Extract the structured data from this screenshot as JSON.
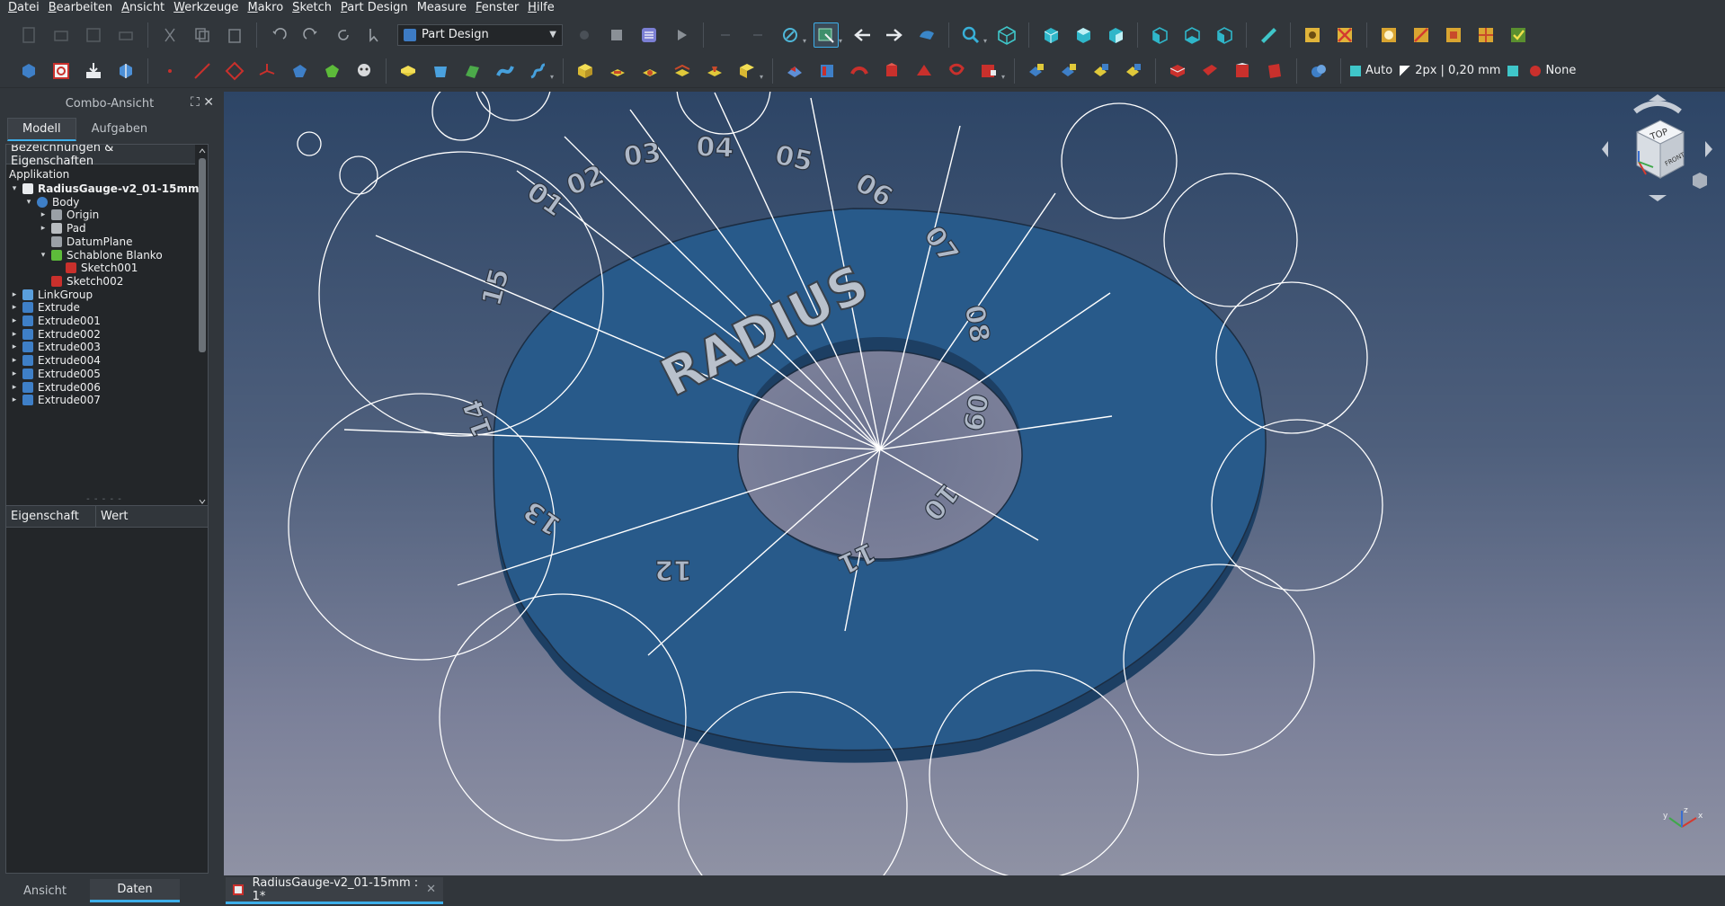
{
  "menu": [
    "Datei",
    "Bearbeiten",
    "Ansicht",
    "Werkzeuge",
    "Makro",
    "Sketch",
    "Part Design",
    "Measure",
    "Fenster",
    "Hilfe"
  ],
  "menu_mnemonics": [
    "D",
    "B",
    "A",
    "W",
    "M",
    "S",
    "P",
    "",
    "F",
    "H"
  ],
  "workbench": "Part Design",
  "toolbar2_draw": {
    "style": "Auto",
    "line": "2px | 0,20 mm",
    "fill": "None"
  },
  "combo": {
    "title": "Combo-Ansicht",
    "tabs": [
      "Modell",
      "Aufgaben"
    ],
    "tree_header": "Bezeichnungen & Eigenschaften",
    "app_label": "Applikation",
    "tree": [
      {
        "label": "RadiusGauge-v2_01-15mm",
        "depth": 0,
        "exp": "▾",
        "icon": "document-icon",
        "bold": true
      },
      {
        "label": "Body",
        "depth": 1,
        "exp": "▾",
        "icon": "body-icon"
      },
      {
        "label": "Origin",
        "depth": 2,
        "exp": "▸",
        "icon": "origin-icon"
      },
      {
        "label": "Pad",
        "depth": 2,
        "exp": "▸",
        "icon": "pad-icon"
      },
      {
        "label": "DatumPlane",
        "depth": 2,
        "exp": "",
        "icon": "datum-plane-icon"
      },
      {
        "label": "Schablone Blanko",
        "depth": 2,
        "exp": "▾",
        "icon": "shape-binder-icon"
      },
      {
        "label": "Sketch001",
        "depth": 3,
        "exp": "",
        "icon": "sketch-icon"
      },
      {
        "label": "Sketch002",
        "depth": 2,
        "exp": "",
        "icon": "sketch-icon"
      },
      {
        "label": "LinkGroup",
        "depth": 0,
        "exp": "▸",
        "icon": "link-group-icon"
      },
      {
        "label": "Extrude",
        "depth": 0,
        "exp": "▸",
        "icon": "extrude-icon"
      },
      {
        "label": "Extrude001",
        "depth": 0,
        "exp": "▸",
        "icon": "extrude-icon"
      },
      {
        "label": "Extrude002",
        "depth": 0,
        "exp": "▸",
        "icon": "extrude-icon"
      },
      {
        "label": "Extrude003",
        "depth": 0,
        "exp": "▸",
        "icon": "extrude-icon"
      },
      {
        "label": "Extrude004",
        "depth": 0,
        "exp": "▸",
        "icon": "extrude-icon"
      },
      {
        "label": "Extrude005",
        "depth": 0,
        "exp": "▸",
        "icon": "extrude-icon"
      },
      {
        "label": "Extrude006",
        "depth": 0,
        "exp": "▸",
        "icon": "extrude-icon"
      },
      {
        "label": "Extrude007",
        "depth": 0,
        "exp": "▸",
        "icon": "extrude-icon"
      }
    ],
    "prop_headers": [
      "Eigenschaft",
      "Wert"
    ]
  },
  "bottom_tabs": [
    "Ansicht",
    "Daten"
  ],
  "document_tab": "RadiusGauge-v2_01-15mm : 1*",
  "model": {
    "title_text": "RADIUS",
    "labels": [
      "01",
      "02",
      "03",
      "04",
      "05",
      "06",
      "07",
      "08",
      "09",
      "10",
      "11",
      "12",
      "13",
      "14",
      "15"
    ]
  },
  "navcube": {
    "top": "TOP",
    "front": "FRONT"
  },
  "axis": {
    "x": "x",
    "y": "y",
    "z": "z"
  },
  "colors": {
    "accent": "#3daee9",
    "model_face": "#285a8a",
    "viewport_top": "#2d4566",
    "viewport_bottom": "#8f92a4"
  }
}
